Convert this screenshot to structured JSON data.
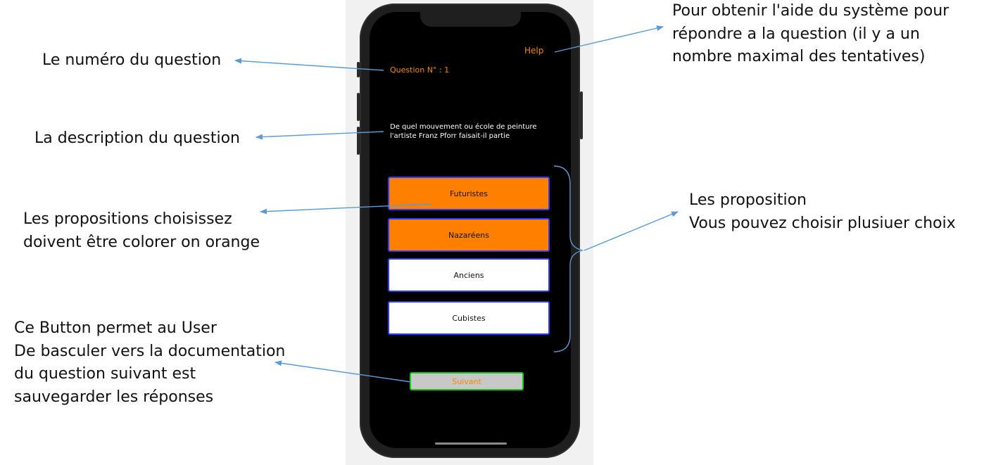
{
  "annotations": {
    "question_number": "Le numéro du question",
    "question_description": "La description du question",
    "selected_choices": [
      "Les propositions choisissez",
      "doivent être colorer on orange"
    ],
    "next_button": [
      "Ce Button permet au User",
      "De basculer vers la documentation",
      "du question suivant est",
      "sauvegarder les réponses"
    ],
    "help": [
      "Pour obtenir l'aide du système pour",
      "répondre a la question (il y a un",
      "nombre maximal des tentatives)"
    ],
    "choices": [
      "Les proposition",
      "Vous pouvez choisir plusiuer choix"
    ]
  },
  "app": {
    "help_label": "Help",
    "question_number": "Question N° : 1",
    "question_text": "De quel mouvement ou école de peinture l'artiste Franz Pforr faisait-il partie",
    "choices": [
      {
        "label": "Futuristes",
        "selected": true
      },
      {
        "label": "Nazaréens",
        "selected": true
      },
      {
        "label": "Anciens",
        "selected": false
      },
      {
        "label": "Cubistes",
        "selected": false
      }
    ],
    "next_label": "Suivant"
  },
  "colors": {
    "accent_orange": "#ff8000",
    "text_orange": "#f08a00",
    "choice_border": "#2b3cff",
    "next_border": "#19c81c",
    "arrow": "#5b9bd5"
  }
}
